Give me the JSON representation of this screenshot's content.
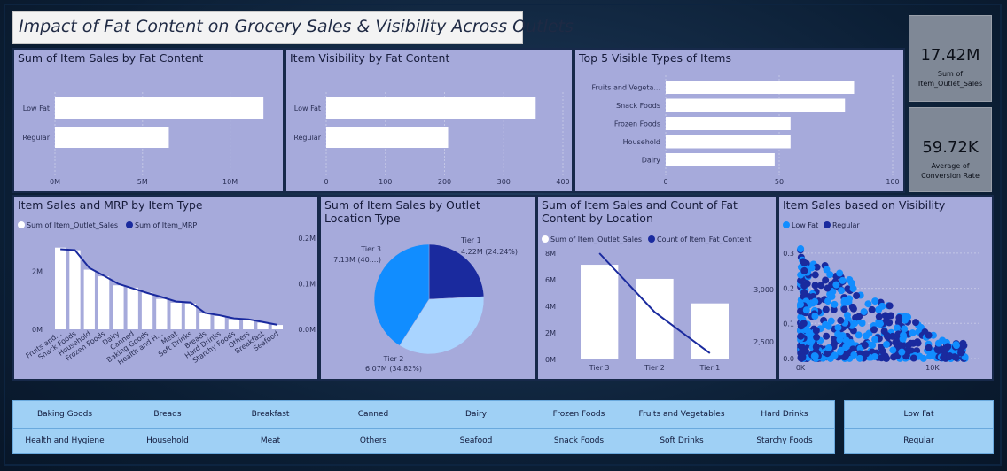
{
  "title": "Impact of Fat Content on Grocery Sales & Visibility Across Outlets",
  "kpis": [
    {
      "value": "17.42M",
      "label_line1": "Sum of",
      "label_line2": "Item_Outlet_Sales"
    },
    {
      "value": "59.72K",
      "label_line1": "Average of",
      "label_line2": "Conversion Rate"
    }
  ],
  "panels": {
    "sales_by_fat": "Sum of Item Sales by Fat Content",
    "visibility_by_fat": "Item Visibility by Fat Content",
    "top5_visible": "Top 5 Visible Types of Items",
    "sales_mrp": "Item Sales and MRP by Item Type",
    "location_pie": "Sum of Item Sales by Outlet Location Type",
    "sales_count_location": "Sum of Item Sales and Count of Fat Content by Location",
    "visibility_scatter": "Item Sales based on Visibility"
  },
  "colors": {
    "bar": "#ffffff",
    "dark_blue": "#1a2a9e",
    "mid_blue": "#118dff",
    "light_blue": "#a9d4ff",
    "panel": "#a6aadb",
    "slicer": "#9fd0f5"
  },
  "slicer_types": [
    "Baking Goods",
    "Breads",
    "Breakfast",
    "Canned",
    "Dairy",
    "Frozen Foods",
    "Fruits and Vegetables",
    "Hard Drinks",
    "Health and Hygiene",
    "Household",
    "Meat",
    "Others",
    "Seafood",
    "Snack Foods",
    "Soft Drinks",
    "Starchy Foods"
  ],
  "slicer_fat": [
    "Low Fat",
    "Regular"
  ],
  "chart_data": [
    {
      "type": "bar",
      "title": "Sum of Item Sales by Fat Content",
      "categories": [
        "Low Fat",
        "Regular"
      ],
      "values": [
        11.9,
        6.5
      ],
      "unit": "M",
      "xticks": [
        "0M",
        "5M",
        "10M"
      ],
      "xlim": [
        0,
        12.5
      ]
    },
    {
      "type": "bar",
      "title": "Item Visibility by Fat Content",
      "categories": [
        "Low Fat",
        "Regular"
      ],
      "values": [
        354,
        206
      ],
      "xticks": [
        "0",
        "100",
        "200",
        "300",
        "400"
      ],
      "xlim": [
        0,
        400
      ]
    },
    {
      "type": "bar",
      "title": "Top 5 Visible Types of Items",
      "categories": [
        "Fruits and Vegeta...",
        "Snack Foods",
        "Frozen Foods",
        "Household",
        "Dairy"
      ],
      "values": [
        83,
        79,
        55,
        55,
        48
      ],
      "xticks": [
        "0",
        "50",
        "100"
      ],
      "xlim": [
        0,
        100
      ]
    },
    {
      "type": "bar",
      "title": "Item Sales and MRP by Item Type",
      "categories": [
        "Fruits and...",
        "Snack Foods",
        "Household",
        "Frozen Foods",
        "Dairy",
        "Canned",
        "Baking Goods",
        "Health and H...",
        "Meat",
        "Soft Drinks",
        "Breads",
        "Hard Drinks",
        "Starchy Foods",
        "Others",
        "Breakfast",
        "Seafood"
      ],
      "series": [
        {
          "name": "Sum of Item_Outlet_Sales",
          "values": [
            2.82,
            2.73,
            2.06,
            1.83,
            1.52,
            1.44,
            1.27,
            1.05,
            0.92,
            0.89,
            0.55,
            0.46,
            0.35,
            0.33,
            0.23,
            0.15
          ]
        },
        {
          "name": "Sum of Item_MRP",
          "values": [
            0.176,
            0.174,
            0.135,
            0.118,
            0.1,
            0.09,
            0.08,
            0.071,
            0.061,
            0.059,
            0.036,
            0.031,
            0.024,
            0.022,
            0.016,
            0.01
          ]
        }
      ],
      "yticks_left": [
        "0M",
        "2M"
      ],
      "yticks_right": [
        "0.0M",
        "0.1M",
        "0.2M"
      ],
      "ylim_left": [
        0,
        3.3
      ],
      "ylim_right": [
        0,
        0.21
      ]
    },
    {
      "type": "pie",
      "title": "Sum of Item Sales by Outlet Location Type",
      "slices": [
        {
          "name": "Tier 1",
          "label": "4.22M (24.24%)",
          "value": 24.24
        },
        {
          "name": "Tier 2",
          "label": "6.07M (34.82%)",
          "value": 34.82
        },
        {
          "name": "Tier 3",
          "label": "7.13M (40....)",
          "value": 40.94
        }
      ]
    },
    {
      "type": "bar",
      "title": "Sum of Item Sales and Count of Fat Content by Location",
      "categories": [
        "Tier 3",
        "Tier 2",
        "Tier 1"
      ],
      "series": [
        {
          "name": "Sum of Item_Outlet_Sales",
          "values": [
            7.13,
            6.07,
            4.22
          ]
        },
        {
          "name": "Count of Item_Fat_Content",
          "values": [
            3350,
            2785,
            2390
          ]
        }
      ],
      "yticks_left": [
        "0M",
        "2M",
        "4M",
        "6M",
        "8M"
      ],
      "yticks_right": [
        "2,500",
        "3,000"
      ],
      "ylim_left": [
        0,
        8
      ],
      "ylim_right": [
        2330,
        3350
      ]
    },
    {
      "type": "scatter",
      "title": "Item Sales based on Visibility",
      "series": [
        {
          "name": "Low Fat"
        },
        {
          "name": "Regular"
        }
      ],
      "xticks": [
        "0K",
        "10K"
      ],
      "yticks": [
        "0.0",
        "0.1",
        "0.2",
        "0.3"
      ],
      "xlim": [
        0,
        13.5
      ],
      "ylim": [
        0,
        0.33
      ]
    }
  ]
}
